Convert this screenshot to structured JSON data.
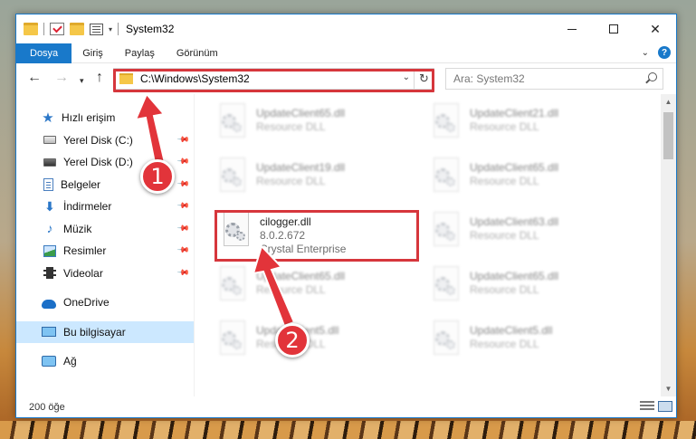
{
  "window": {
    "title": "System32"
  },
  "ribbon": {
    "tabs": [
      "Dosya",
      "Giriş",
      "Paylaş",
      "Görünüm"
    ]
  },
  "nav": {
    "address": "C:\\Windows\\System32",
    "search_placeholder": "Ara: System32"
  },
  "sidebar": {
    "items": [
      {
        "label": "Hızlı erişim",
        "icon": "star-icon"
      },
      {
        "label": "Yerel Disk (C:)",
        "icon": "disk-icon"
      },
      {
        "label": "Yerel Disk (D:)",
        "icon": "disk-icon"
      },
      {
        "label": "Belgeler",
        "icon": "document-icon"
      },
      {
        "label": "İndirmeler",
        "icon": "download-icon"
      },
      {
        "label": "Müzik",
        "icon": "music-icon"
      },
      {
        "label": "Resimler",
        "icon": "pictures-icon"
      },
      {
        "label": "Videolar",
        "icon": "video-icon"
      },
      {
        "label": "OneDrive",
        "icon": "cloud-icon"
      },
      {
        "label": "Bu bilgisayar",
        "icon": "computer-icon"
      },
      {
        "label": "Ağ",
        "icon": "network-icon"
      }
    ]
  },
  "files": [
    {
      "name": "UpdateClient65.dll",
      "desc": "Resource DLL"
    },
    {
      "name": "UpdateClient21.dll",
      "desc": "Resource DLL"
    },
    {
      "name": "UpdateClient19.dll",
      "desc": "Resource DLL"
    },
    {
      "name": "UpdateClient65.dll",
      "desc": "Resource DLL"
    },
    {
      "name": "cilogger.dll",
      "version": "8.0.2.672",
      "company": "Crystal Enterprise"
    },
    {
      "name": "UpdateClient63.dll",
      "desc": "Resource DLL"
    },
    {
      "name": "UpdateClient65.dll",
      "desc": "Resource DLL"
    },
    {
      "name": "UpdateClient65.dll",
      "desc": "Resource DLL"
    },
    {
      "name": "UpdateClient5.dll",
      "desc": "Resource DLL"
    },
    {
      "name": "UpdateClient5.dll",
      "desc": "Resource DLL"
    }
  ],
  "status": {
    "item_count": "200 öğe"
  },
  "callouts": [
    "1",
    "2"
  ],
  "colors": {
    "accent": "#1979ca",
    "highlight": "#d6363c"
  }
}
